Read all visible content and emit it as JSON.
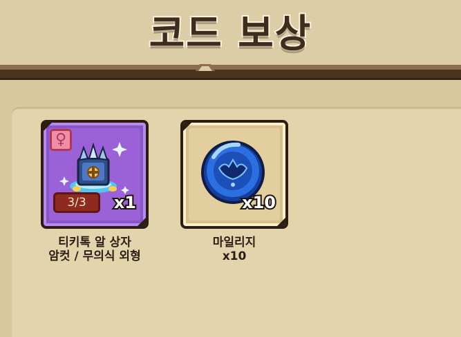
{
  "title": "코드 보상",
  "rewards": [
    {
      "name_line1": "티키톡 알 상자",
      "name_line2": "암컷 / 무의식 외형",
      "quantity": "x1",
      "count": "3/3",
      "gender_symbol": "♀",
      "icon": "egg-box-icon",
      "rarity_color": "#8a55c5"
    },
    {
      "name_line1": "마일리지",
      "name_line2": "x10",
      "quantity": "x10",
      "icon": "mileage-coin-icon",
      "rarity_color": "#d8c08e"
    }
  ]
}
